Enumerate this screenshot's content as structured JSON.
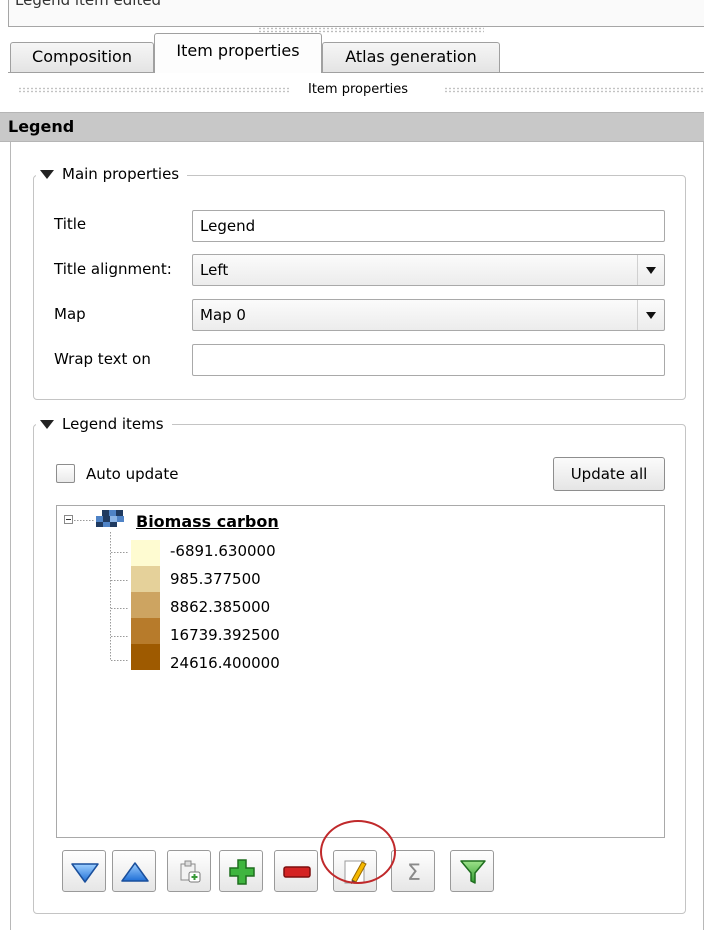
{
  "status_text": "Legend item edited",
  "tabs": [
    {
      "label": "Composition",
      "active": false
    },
    {
      "label": "Item properties",
      "active": true
    },
    {
      "label": "Atlas generation",
      "active": false
    }
  ],
  "dock_title": "Item properties",
  "section_title": "Legend",
  "main_properties": {
    "group_title": "Main properties",
    "title_label": "Title",
    "title_value": "Legend",
    "alignment_label": "Title alignment:",
    "alignment_value": "Left",
    "map_label": "Map",
    "map_value": "Map 0",
    "wrap_label": "Wrap text on",
    "wrap_value": ""
  },
  "legend_items": {
    "group_title": "Legend items",
    "auto_update_label": "Auto update",
    "auto_update_checked": false,
    "update_all_label": "Update all",
    "layer_name": "Biomass carbon",
    "classes": [
      {
        "label": "-6891.630000",
        "color": "#fefbd1"
      },
      {
        "label": "985.377500",
        "color": "#e5d19a"
      },
      {
        "label": "8862.385000",
        "color": "#cda461"
      },
      {
        "label": "16739.392500",
        "color": "#b77b2b"
      },
      {
        "label": "24616.400000",
        "color": "#9e5a00"
      }
    ]
  },
  "toolbar_buttons": [
    {
      "name": "move-down",
      "icon": "triangle-down-icon"
    },
    {
      "name": "move-up",
      "icon": "triangle-up-icon"
    },
    {
      "name": "add-group",
      "icon": "add-group-icon"
    },
    {
      "name": "add-item",
      "icon": "plus-icon"
    },
    {
      "name": "remove-item",
      "icon": "minus-icon"
    },
    {
      "name": "edit-item",
      "icon": "pencil-icon",
      "highlighted": true
    },
    {
      "name": "count-features",
      "icon": "sigma-icon"
    },
    {
      "name": "filter-legend",
      "icon": "funnel-icon"
    }
  ],
  "colors": {
    "highlight": "#c0292b",
    "section_header_bg": "#c8c8c8"
  }
}
